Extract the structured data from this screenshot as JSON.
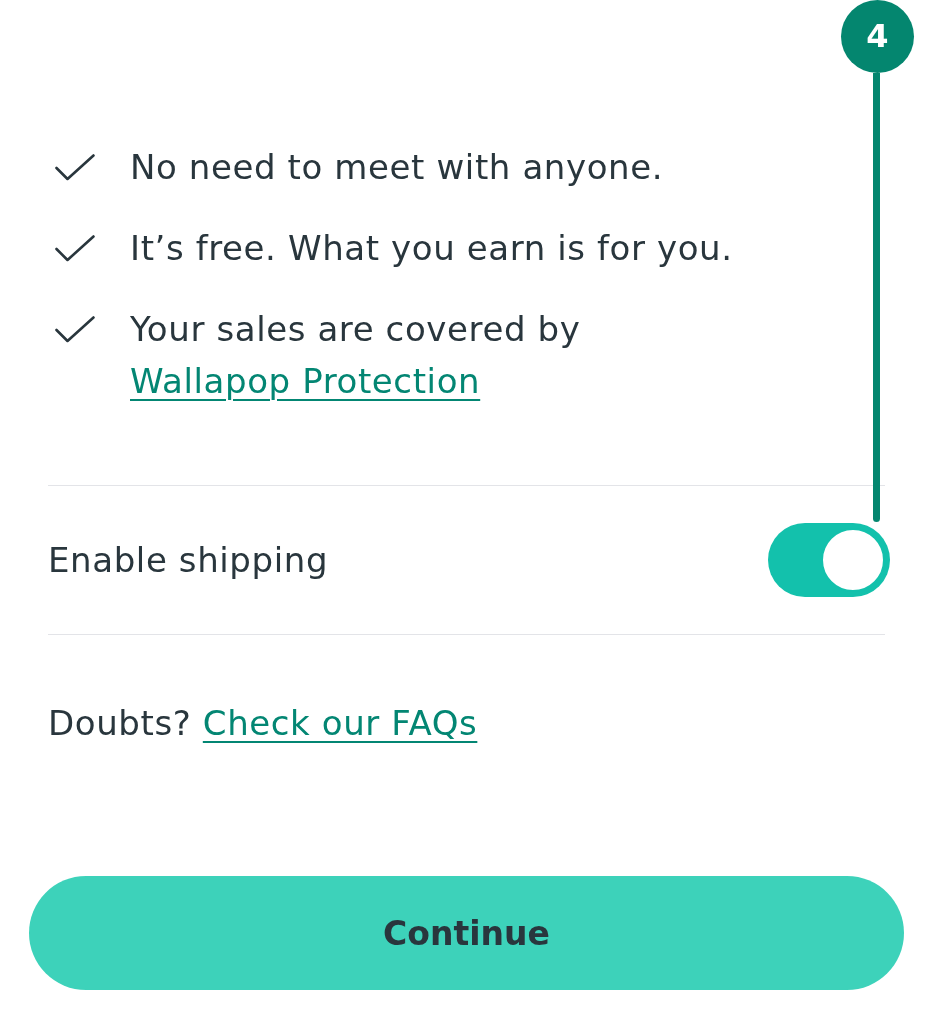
{
  "benefits": [
    {
      "text": "No need to meet with anyone."
    },
    {
      "text": "It’s free. What you earn is for you."
    },
    {
      "text": "Your sales are covered by",
      "link": "Wallapop Protection"
    }
  ],
  "shipping_toggle": {
    "label": "Enable shipping",
    "on": true
  },
  "help": {
    "text": "Doubts?",
    "link": "Check our FAQs"
  },
  "continue_button": {
    "label": "Continue"
  },
  "callout": {
    "label": "4"
  }
}
